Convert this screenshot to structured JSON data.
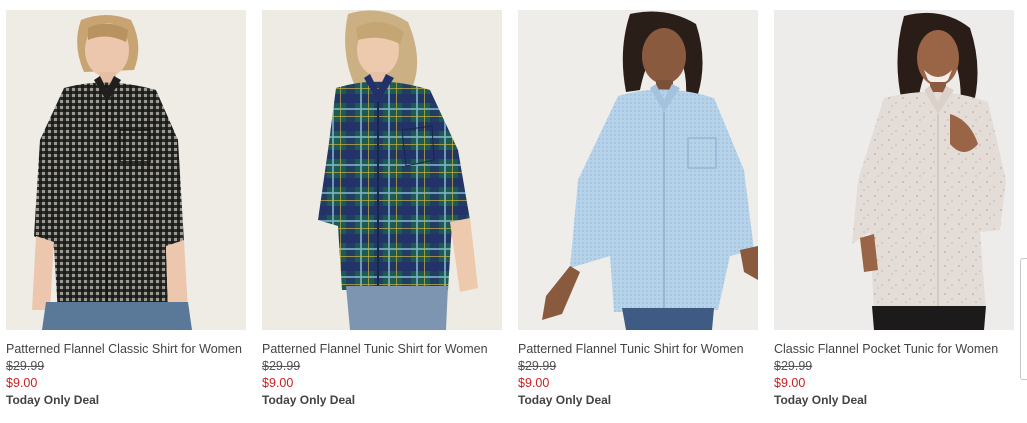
{
  "colors": {
    "sale_price": "#cc1f1f",
    "text": "#444444"
  },
  "products": [
    {
      "name": "Patterned Flannel Classic Shirt for Women",
      "original_price": "$29.99",
      "sale_price": "$9.00",
      "deal": "Today Only Deal",
      "image_icon": "black-gingham-flannel-shirt-photo"
    },
    {
      "name": "Patterned Flannel Tunic Shirt for Women",
      "original_price": "$29.99",
      "sale_price": "$9.00",
      "deal": "Today Only Deal",
      "image_icon": "green-plaid-flannel-tunic-photo"
    },
    {
      "name": "Patterned Flannel Tunic Shirt for Women",
      "original_price": "$29.99",
      "sale_price": "$9.00",
      "deal": "Today Only Deal",
      "image_icon": "light-blue-flannel-tunic-photo"
    },
    {
      "name": "Classic Flannel Pocket Tunic for Women",
      "original_price": "$29.99",
      "sale_price": "$9.00",
      "deal": "Today Only Deal",
      "image_icon": "cream-flannel-pocket-tunic-photo"
    }
  ]
}
